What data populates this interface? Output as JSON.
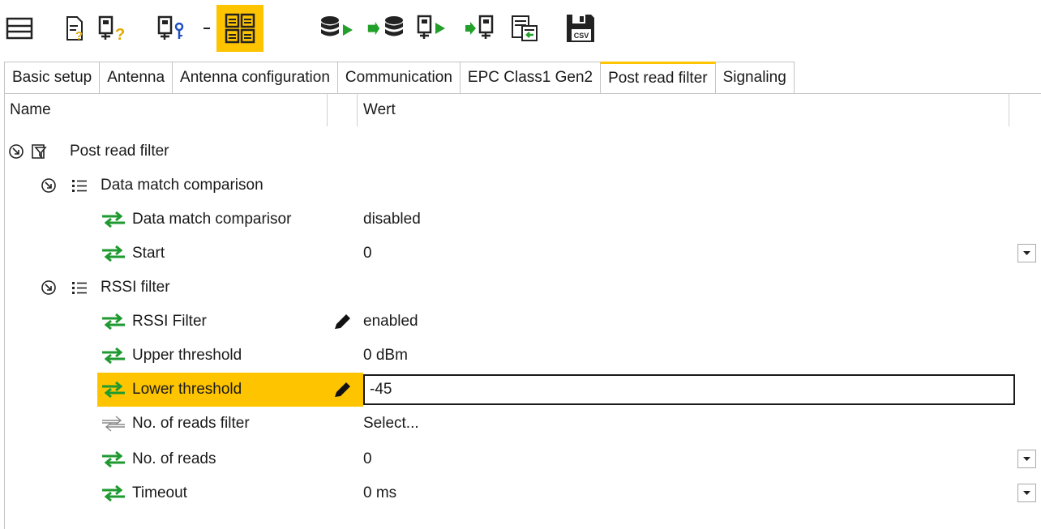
{
  "toolbar": {
    "buttons": [
      {
        "name": "list-view-icon"
      },
      {
        "name": "document-help-icon"
      },
      {
        "name": "device-help-icon"
      },
      {
        "name": "device-info-icon"
      },
      {
        "name": "dropdown-arrow-icon"
      },
      {
        "name": "grid-view-icon",
        "active": true
      },
      {
        "name": "database-export-icon"
      },
      {
        "name": "database-import-icon"
      },
      {
        "name": "device-export-icon"
      },
      {
        "name": "device-import-icon"
      },
      {
        "name": "document-import-icon"
      },
      {
        "name": "csv-save-icon",
        "badge": "CSV"
      }
    ],
    "accent_color": "#ffc400"
  },
  "tabs": [
    {
      "label": "Basic setup"
    },
    {
      "label": "Antenna"
    },
    {
      "label": "Antenna configuration"
    },
    {
      "label": "Communication"
    },
    {
      "label": "EPC Class1 Gen2"
    },
    {
      "label": "Post read filter",
      "selected": true
    },
    {
      "label": "Signaling"
    }
  ],
  "grid": {
    "columns": {
      "name": "Name",
      "value": "Wert"
    },
    "rows": [
      {
        "label": "Post read filter",
        "value": "",
        "kind": "group",
        "icon": "filter-icon"
      },
      {
        "label": "Data match comparison",
        "value": "",
        "kind": "group",
        "icon": "list-icon"
      },
      {
        "label": "Data match comparisor",
        "value": "disabled",
        "kind": "property",
        "icon": "swap-arrows-icon"
      },
      {
        "label": "Start",
        "value": "0",
        "kind": "property",
        "icon": "swap-arrows-icon",
        "dropdown": true
      },
      {
        "label": "RSSI filter",
        "value": "",
        "kind": "group",
        "icon": "list-icon"
      },
      {
        "label": "RSSI Filter",
        "value": "enabled",
        "kind": "property",
        "icon": "swap-arrows-icon",
        "edited": true
      },
      {
        "label": "Upper threshold",
        "value": "0 dBm",
        "kind": "property",
        "icon": "swap-arrows-icon"
      },
      {
        "label": "Lower threshold",
        "value": "-45",
        "kind": "property",
        "icon": "swap-arrows-icon",
        "edited": true,
        "selected": true,
        "editing": true
      },
      {
        "label": "No. of reads filter",
        "value": "Select...",
        "kind": "property",
        "icon": "swap-arrows-icon",
        "disabled": true
      },
      {
        "label": "No. of reads",
        "value": "0",
        "kind": "property",
        "icon": "swap-arrows-icon",
        "dropdown": true
      },
      {
        "label": "Timeout",
        "value": "0 ms",
        "kind": "property",
        "icon": "swap-arrows-icon",
        "dropdown": true
      }
    ]
  }
}
